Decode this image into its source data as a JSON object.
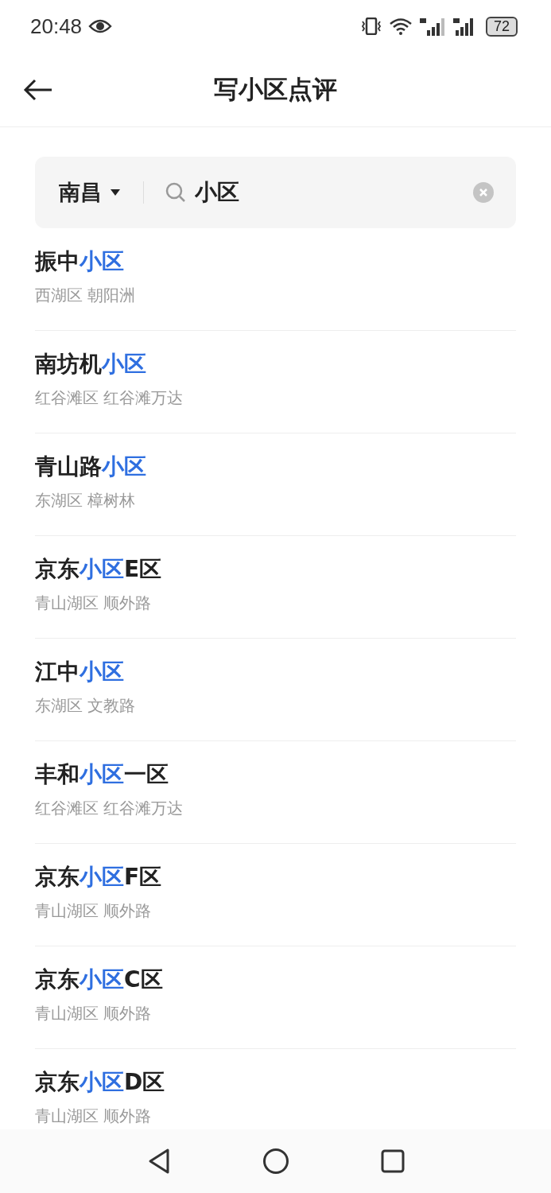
{
  "status_bar": {
    "time": "20:48",
    "battery": "72"
  },
  "header": {
    "title": "写小区点评"
  },
  "search": {
    "city": "南昌",
    "value": "小区"
  },
  "results": [
    {
      "title": [
        {
          "text": "振中",
          "highlight": false
        },
        {
          "text": "小区",
          "highlight": true
        }
      ],
      "location": "西湖区 朝阳洲"
    },
    {
      "title": [
        {
          "text": "南坊机",
          "highlight": false
        },
        {
          "text": "小区",
          "highlight": true
        }
      ],
      "location": "红谷滩区 红谷滩万达"
    },
    {
      "title": [
        {
          "text": "青山路",
          "highlight": false
        },
        {
          "text": "小区",
          "highlight": true
        }
      ],
      "location": "东湖区 樟树林"
    },
    {
      "title": [
        {
          "text": "京东",
          "highlight": false
        },
        {
          "text": "小区",
          "highlight": true
        },
        {
          "text": "E区",
          "highlight": false
        }
      ],
      "location": "青山湖区 顺外路"
    },
    {
      "title": [
        {
          "text": "江中",
          "highlight": false
        },
        {
          "text": "小区",
          "highlight": true
        }
      ],
      "location": "东湖区 文教路"
    },
    {
      "title": [
        {
          "text": "丰和",
          "highlight": false
        },
        {
          "text": "小区",
          "highlight": true
        },
        {
          "text": "一区",
          "highlight": false
        }
      ],
      "location": "红谷滩区 红谷滩万达"
    },
    {
      "title": [
        {
          "text": "京东",
          "highlight": false
        },
        {
          "text": "小区",
          "highlight": true
        },
        {
          "text": "F区",
          "highlight": false
        }
      ],
      "location": "青山湖区 顺外路"
    },
    {
      "title": [
        {
          "text": "京东",
          "highlight": false
        },
        {
          "text": "小区",
          "highlight": true
        },
        {
          "text": "C区",
          "highlight": false
        }
      ],
      "location": "青山湖区 顺外路"
    },
    {
      "title": [
        {
          "text": "京东",
          "highlight": false
        },
        {
          "text": "小区",
          "highlight": true
        },
        {
          "text": "D区",
          "highlight": false
        }
      ],
      "location": "青山湖区 顺外路"
    }
  ]
}
